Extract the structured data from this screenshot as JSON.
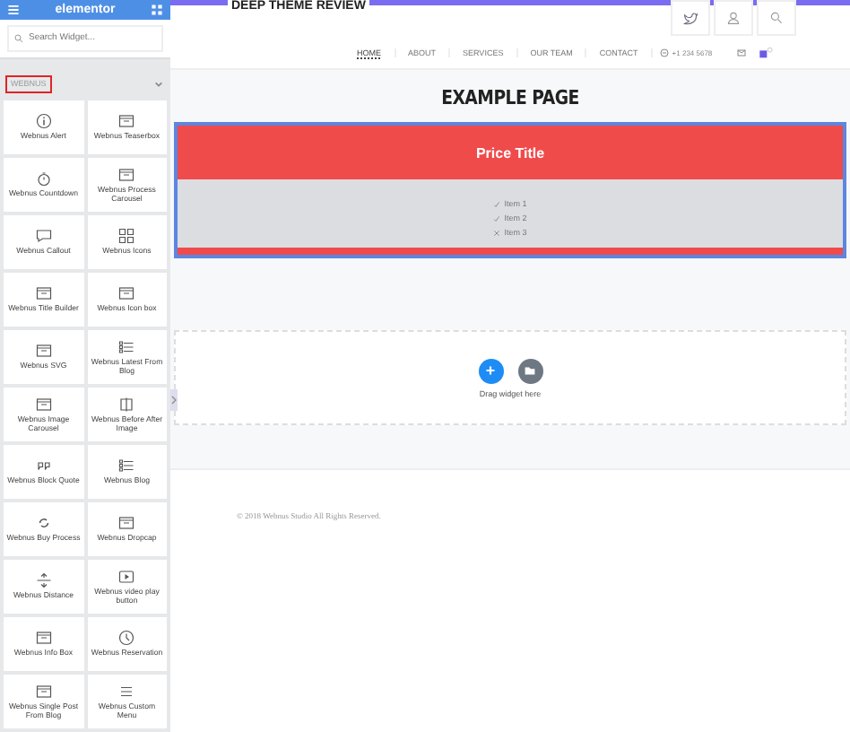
{
  "sidebar": {
    "logo": "elementor",
    "search": {
      "placeholder": "Search Widget..."
    },
    "section": {
      "title": "WEBNUS",
      "expanded": true
    },
    "widgets": [
      "Webnus Alert",
      "Webnus Teaserbox",
      "Webnus Countdown",
      "Webnus Process Carousel",
      "Webnus Callout",
      "Webnus Icons",
      "Webnus Title Builder",
      "Webnus Icon box",
      "Webnus SVG",
      "Webnus Latest From Blog",
      "Webnus Image Carousel",
      "Webnus Before After Image",
      "Webnus Block Quote",
      "Webnus Blog",
      "Webnus Buy Process",
      "Webnus Dropcap",
      "Webnus Distance",
      "Webnus video play button",
      "Webnus Info Box",
      "Webnus Reservation",
      "Webnus Single Post From Blog",
      "Webnus Custom Menu"
    ]
  },
  "header": {
    "site_title": "DEEP THEME REVIEW",
    "nav": [
      {
        "label": "HOME",
        "selected": true
      },
      {
        "label": "ABOUT",
        "selected": false
      },
      {
        "label": "SERVICES",
        "selected": false
      },
      {
        "label": "OUR TEAM",
        "selected": false
      },
      {
        "label": "CONTACT",
        "selected": false
      }
    ],
    "phone": "+1 234 5678"
  },
  "page_title": "EXAMPLE PAGE",
  "price_table": {
    "title": "Price Title",
    "items": [
      {
        "label": "Item 1",
        "included": true
      },
      {
        "label": "Item 2",
        "included": true
      },
      {
        "label": "Item 3",
        "included": false
      }
    ]
  },
  "drop_zone": {
    "hint": "Drag widget here"
  },
  "footer": {
    "copyright": "© 2018 Webnus Studio All Rights Reserved."
  }
}
